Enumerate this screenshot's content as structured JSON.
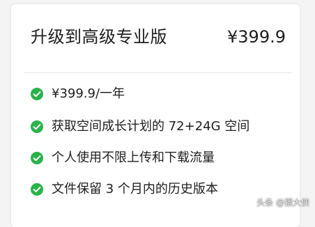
{
  "plan": {
    "title": "升级到高级专业版",
    "price": "¥399.9"
  },
  "features": [
    {
      "icon": "check-circle-icon",
      "text": "¥399.9/一年"
    },
    {
      "icon": "check-circle-icon",
      "text": "获取空间成长计划的 72+24G 空间"
    },
    {
      "icon": "check-circle-icon",
      "text": "个人使用不限上传和下载流量"
    },
    {
      "icon": "check-circle-icon",
      "text": "文件保留 3 个月内的历史版本"
    }
  ],
  "watermark": "头条 @猥大侠",
  "colors": {
    "check_green": "#2bb24c",
    "text": "#1e1e1e"
  }
}
